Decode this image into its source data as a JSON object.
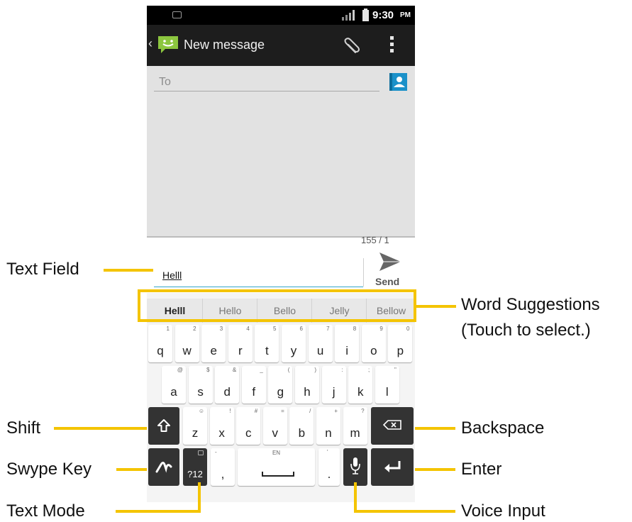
{
  "status_bar": {
    "time": "9:30",
    "ampm": "PM"
  },
  "action_bar": {
    "back_glyph": "‹",
    "title": "New message",
    "icons": [
      "messaging-app-icon",
      "paperclip-icon",
      "overflow-menu-icon"
    ]
  },
  "compose": {
    "to_placeholder": "To",
    "contact_icon": "contact-icon",
    "counter": "155 / 1"
  },
  "text_field": {
    "value": "Helll"
  },
  "send": {
    "label": "Send"
  },
  "suggestions": [
    "Helll",
    "Hello",
    "Bello",
    "Jelly",
    "Bellow"
  ],
  "keyboard": {
    "row1": [
      {
        "k": "q",
        "h": "1"
      },
      {
        "k": "w",
        "h": "2"
      },
      {
        "k": "e",
        "h": "3"
      },
      {
        "k": "r",
        "h": "4"
      },
      {
        "k": "t",
        "h": "5"
      },
      {
        "k": "y",
        "h": "6"
      },
      {
        "k": "u",
        "h": "7"
      },
      {
        "k": "i",
        "h": "8"
      },
      {
        "k": "o",
        "h": "9"
      },
      {
        "k": "p",
        "h": "0"
      }
    ],
    "row2": [
      {
        "k": "a",
        "h": "@"
      },
      {
        "k": "s",
        "h": "$"
      },
      {
        "k": "d",
        "h": "&"
      },
      {
        "k": "f",
        "h": "_"
      },
      {
        "k": "g",
        "h": "("
      },
      {
        "k": "h",
        "h": ")"
      },
      {
        "k": "j",
        "h": ":"
      },
      {
        "k": "k",
        "h": ";"
      },
      {
        "k": "l",
        "h": "\""
      }
    ],
    "row3": [
      {
        "k": "z",
        "h": "☺"
      },
      {
        "k": "x",
        "h": "!"
      },
      {
        "k": "c",
        "h": "#"
      },
      {
        "k": "v",
        "h": "="
      },
      {
        "k": "b",
        "h": "/"
      },
      {
        "k": "n",
        "h": "+"
      },
      {
        "k": "m",
        "h": "?"
      }
    ],
    "mode_label": "?12",
    "comma": ",",
    "comma_hint": "-",
    "space_hint": "EN",
    "period": ".",
    "period_hint": "'"
  },
  "callouts": {
    "text_field": "Text Field",
    "word_suggestions": "Word Suggestions",
    "touch_to_select": "(Touch to select.)",
    "shift": "Shift",
    "backspace": "Backspace",
    "swype_key": "Swype Key",
    "enter": "Enter",
    "text_mode": "Text Mode",
    "voice_input": "Voice Input"
  },
  "colors": {
    "callout": "#f4c400",
    "action_bar": "#1d1d1d",
    "compose_bg": "#e2e2e2",
    "dark_key": "#333333",
    "contact_icon": "#1b91c9",
    "app_icon": "#8cc63f"
  }
}
